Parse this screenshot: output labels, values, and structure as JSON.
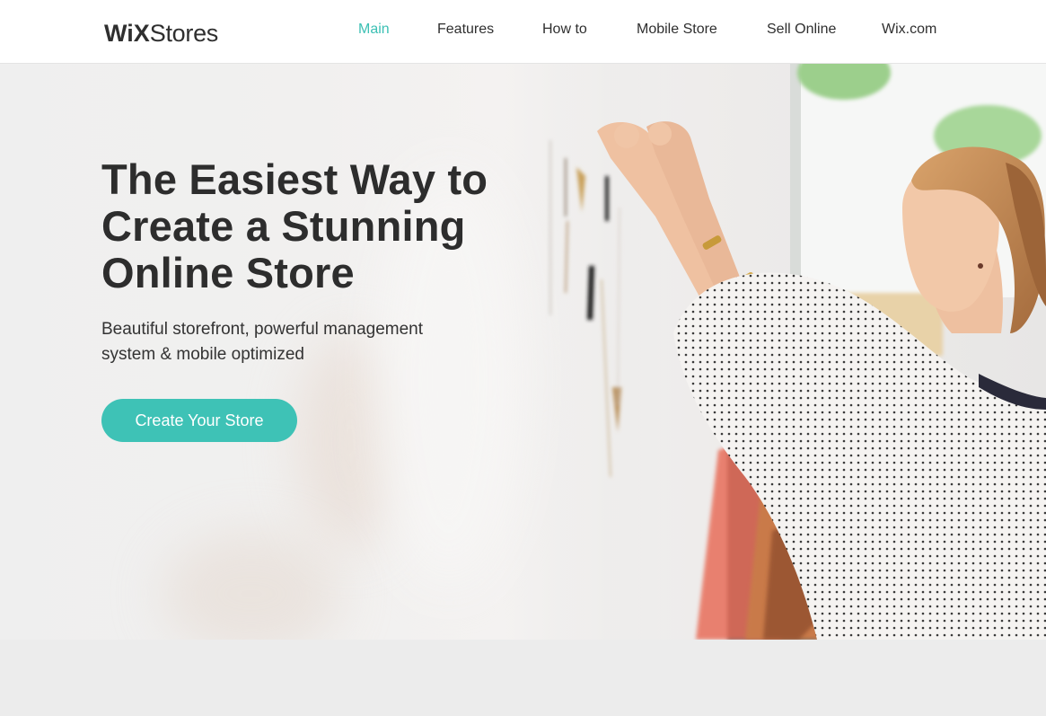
{
  "header": {
    "logo": {
      "bold": "WiX",
      "light": "Stores"
    },
    "nav": [
      {
        "label": "Main",
        "active": true
      },
      {
        "label": "Features",
        "active": false
      },
      {
        "label": "How to",
        "active": false
      },
      {
        "label": "Mobile Store",
        "active": false
      },
      {
        "label": "Sell Online",
        "active": false
      },
      {
        "label": "Wix.com",
        "active": false
      }
    ]
  },
  "hero": {
    "headline": [
      "The Easiest Way to",
      "Create a Stunning",
      "Online Store"
    ],
    "subtitle": [
      "Beautiful storefront, powerful management",
      "system & mobile optimized"
    ],
    "cta_label": "Create Your Store",
    "image": "woman-hanging-jewelry-photo"
  },
  "colors": {
    "accent": "#3ec2b6",
    "active_nav": "#3cc0b4",
    "text": "#2d2d2d",
    "header_bg": "#ffffff",
    "footer_bg": "#ececec"
  }
}
